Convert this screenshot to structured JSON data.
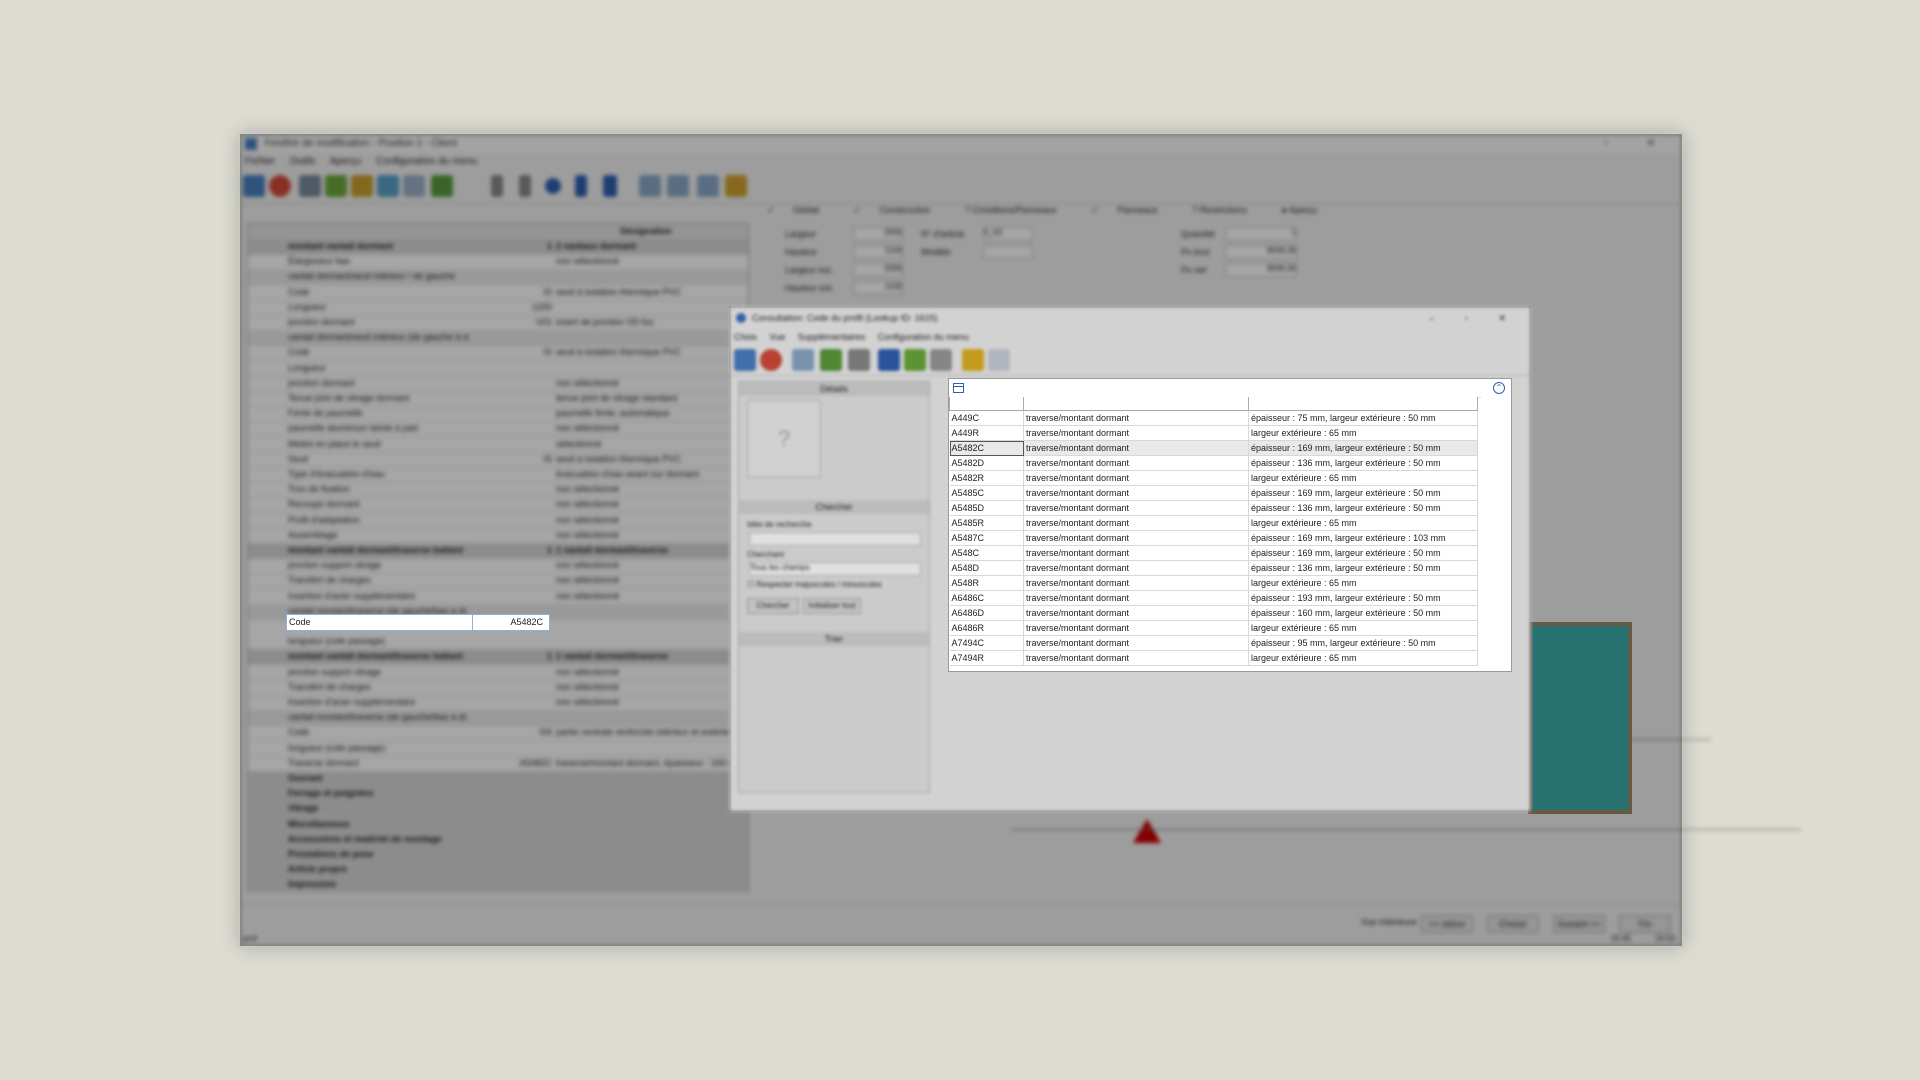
{
  "main_window": {
    "title": "Fenêtre de modification - Position 1 - Client",
    "menu": [
      "Fichier",
      "Outils",
      "Aperçu",
      "Configuration du menu"
    ],
    "left_grid": {
      "headers": [
        "",
        "",
        "Désignation"
      ],
      "rows": [
        {
          "type": "grp",
          "label": "montant vantail dormant",
          "value": "1",
          "desc": "2 vantaux dormant"
        },
        {
          "type": "row",
          "label": "Élargisseur bas",
          "value": "",
          "desc": "non sélectionné"
        },
        {
          "type": "sub",
          "label": "vantail dormant/seuil intérieur / de gauche",
          "value": "",
          "desc": ""
        },
        {
          "type": "row",
          "label": "Code",
          "value": "IS",
          "desc": "seuil à isolation thermique PVC"
        },
        {
          "type": "row",
          "label": "Longueur",
          "value": "1200",
          "desc": ""
        },
        {
          "type": "row",
          "label": "jonction dormant",
          "value": "V01",
          "desc": "insert de jonction VD fus"
        },
        {
          "type": "sub",
          "label": "vantail dormant/seuil intérieur (de gauche à d.",
          "value": "",
          "desc": ""
        },
        {
          "type": "row",
          "label": "Code",
          "value": "IS",
          "desc": "seuil à isolation thermique PVC"
        },
        {
          "type": "row",
          "label": "Longueur",
          "value": "",
          "desc": ""
        },
        {
          "type": "row",
          "label": "jonction dormant",
          "value": "",
          "desc": "non sélectionné"
        },
        {
          "type": "row",
          "label": "Tenue joint de vitrage dormant",
          "value": "",
          "desc": "tenue joint de vitrage standard"
        },
        {
          "type": "row",
          "label": "Fente de paumelle",
          "value": "",
          "desc": "paumelle fente, automatique"
        },
        {
          "type": "row",
          "label": "paumelle aluminium teinte à part",
          "value": "",
          "desc": "non sélectionné"
        },
        {
          "type": "row",
          "label": "Mettre en place le seuil",
          "value": "",
          "desc": "sélectionné"
        },
        {
          "type": "row",
          "label": "Seuil",
          "value": "IS",
          "desc": "seuil à isolation thermique PVC"
        },
        {
          "type": "row",
          "label": "Type d'évacuation d'eau",
          "value": "",
          "desc": "évacuation d'eau avant sur dormant"
        },
        {
          "type": "row",
          "label": "Trou de fixation",
          "value": "",
          "desc": "non sélectionné"
        },
        {
          "type": "row",
          "label": "Recoupe dormant",
          "value": "",
          "desc": "non sélectionné"
        },
        {
          "type": "row",
          "label": "Profil d'adaptation",
          "value": "",
          "desc": "non sélectionné"
        },
        {
          "type": "row",
          "label": "Assemblage",
          "value": "",
          "desc": "non sélectionné"
        },
        {
          "type": "grp",
          "label": "montant vantail dormant/traverse battant",
          "value": "1",
          "desc": "1 vantail dormant/traverse"
        },
        {
          "type": "row",
          "label": "jonction support vitrage",
          "value": "",
          "desc": "non sélectionné"
        },
        {
          "type": "row",
          "label": "Transfert de charges",
          "value": "",
          "desc": "non sélectionné"
        },
        {
          "type": "row",
          "label": "Insertion d'acier supplémentaire",
          "value": "",
          "desc": "non sélectionné"
        },
        {
          "type": "sub",
          "label": "vantail montant/traverse (de gauche/bas à dr.",
          "value": "",
          "desc": ""
        }
      ],
      "rows_after": [
        {
          "type": "row",
          "label": "longueur (cote passage)",
          "value": "",
          "desc": ""
        },
        {
          "type": "grp",
          "label": "montant vantail dormant/traverse battant",
          "value": "1",
          "desc": "1 vantail dormant/traverse"
        },
        {
          "type": "row",
          "label": "jonction support vitrage",
          "value": "",
          "desc": "non sélectionné"
        },
        {
          "type": "row",
          "label": "Transfert de charges",
          "value": "",
          "desc": "non sélectionné"
        },
        {
          "type": "row",
          "label": "Insertion d'acier supplémentaire",
          "value": "",
          "desc": "non sélectionné"
        },
        {
          "type": "sub",
          "label": "vantail montant/traverse (de gauche/bas à dr.",
          "value": "",
          "desc": ""
        },
        {
          "type": "row",
          "label": "Code",
          "value": "I04",
          "desc": "partie centrale renforcée intérieur et extérieur"
        },
        {
          "type": "row",
          "label": "longueur (cote passage)",
          "value": "",
          "desc": ""
        },
        {
          "type": "row",
          "label": "Traverse dormant",
          "value": "A5482C",
          "desc": "traverse/montant dormant, épaisseur : 169 mm"
        },
        {
          "type": "grp",
          "label": "Ouvrant",
          "value": "",
          "desc": ""
        },
        {
          "type": "grp",
          "label": "Ferrage et poignées",
          "value": "",
          "desc": ""
        },
        {
          "type": "grp",
          "label": "Vitrage",
          "value": "",
          "desc": ""
        },
        {
          "type": "grp",
          "label": "Miscellaneous",
          "value": "",
          "desc": ""
        },
        {
          "type": "grp",
          "label": "Accessoires et matériel de montage",
          "value": "",
          "desc": ""
        },
        {
          "type": "grp",
          "label": "Prestations de pose",
          "value": "",
          "desc": ""
        },
        {
          "type": "grp",
          "label": "Article propre",
          "value": "",
          "desc": ""
        },
        {
          "type": "grp",
          "label": "Impression",
          "value": "",
          "desc": ""
        }
      ]
    },
    "tabs": [
      "Global",
      "Construction",
      "Croisillons/Panneaux",
      "Panneaux",
      "Restrictions",
      "Aperçu"
    ],
    "form": {
      "largeur_label": "Largeur",
      "largeur_value": "2000",
      "hauteur_label": "Hauteur",
      "hauteur_value": "1100",
      "largeur_ext_label": "Largeur ext.",
      "largeur_ext_value": "2000",
      "hauteur_ext_label": "Hauteur ext.",
      "hauteur_ext_value": "1100",
      "serie_label": "N° d'article",
      "serie_value": "5_03",
      "modele_label": "Modèle",
      "quantite_label": "Quantité",
      "quantite_value": "1",
      "prix_label": "Px brut",
      "prix_value": "8049,30",
      "prix_net_label": "Px net",
      "prix_net_value": "8049,30"
    },
    "bottom_buttons": [
      "Vue intérieure",
      "<< retour",
      "Choisir",
      "Suivant >>",
      "Fin"
    ],
    "status": [
      "prof",
      "20:45",
      "16:03"
    ]
  },
  "code_cell": {
    "label": "Code",
    "value": "A5482C"
  },
  "lookup_dialog": {
    "title": "Consultation: Code du profil (Lookup ID: 1615)",
    "menu": [
      "Choix",
      "Vue",
      "Supplémentaires",
      "Configuration du menu"
    ],
    "left_panel": {
      "details_header": "Détails",
      "search_header": "Chercher",
      "search_label": "Idée de recherche",
      "field_label": "Cherchant",
      "field_value": "Tous les champs",
      "checkbox_label": "Respecter majuscules / minuscules",
      "search_button": "Chercher",
      "reset_button": "Initialiser tout",
      "sort_header": "Trier"
    }
  },
  "results": {
    "columns": [
      "",
      "",
      ""
    ],
    "rows": [
      {
        "code": "A449C",
        "designation": "traverse/montant dormant",
        "details": "épaisseur : 75 mm, largeur extérieure : 50 mm"
      },
      {
        "code": "A449R",
        "designation": "traverse/montant dormant",
        "details": "largeur extérieure : 65 mm"
      },
      {
        "code": "A5482C",
        "designation": "traverse/montant dormant",
        "details": "épaisseur : 169 mm, largeur extérieure : 50 mm",
        "selected": true
      },
      {
        "code": "A5482D",
        "designation": "traverse/montant dormant",
        "details": "épaisseur : 136 mm, largeur extérieure : 50 mm"
      },
      {
        "code": "A5482R",
        "designation": "traverse/montant dormant",
        "details": "largeur extérieure : 65 mm"
      },
      {
        "code": "A5485C",
        "designation": "traverse/montant dormant",
        "details": "épaisseur : 169 mm, largeur extérieure : 50 mm"
      },
      {
        "code": "A5485D",
        "designation": "traverse/montant dormant",
        "details": "épaisseur : 136 mm, largeur extérieure : 50 mm"
      },
      {
        "code": "A5485R",
        "designation": "traverse/montant dormant",
        "details": "largeur extérieure : 65 mm"
      },
      {
        "code": "A5487C",
        "designation": "traverse/montant dormant",
        "details": "épaisseur : 169 mm, largeur extérieure : 103 mm"
      },
      {
        "code": "A548C",
        "designation": "traverse/montant dormant",
        "details": "épaisseur : 169 mm, largeur extérieure : 50 mm"
      },
      {
        "code": "A548D",
        "designation": "traverse/montant dormant",
        "details": "épaisseur : 136 mm, largeur extérieure : 50 mm"
      },
      {
        "code": "A548R",
        "designation": "traverse/montant dormant",
        "details": "largeur extérieure : 65 mm"
      },
      {
        "code": "A6486C",
        "designation": "traverse/montant dormant",
        "details": "épaisseur : 193 mm, largeur extérieure : 50 mm"
      },
      {
        "code": "A6486D",
        "designation": "traverse/montant dormant",
        "details": "épaisseur : 160 mm, largeur extérieure : 50 mm"
      },
      {
        "code": "A6486R",
        "designation": "traverse/montant dormant",
        "details": "largeur extérieure : 65 mm"
      },
      {
        "code": "A7494C",
        "designation": "traverse/montant dormant",
        "details": "épaisseur : 95 mm, largeur extérieure : 50 mm"
      },
      {
        "code": "A7494R",
        "designation": "traverse/montant dormant",
        "details": "largeur extérieure : 65 mm"
      }
    ]
  },
  "colors": {
    "accent": "#2f5fb0",
    "preview_glass": "#40b0b0",
    "marker": "#cc0000",
    "ok": "#2a9a2a"
  }
}
